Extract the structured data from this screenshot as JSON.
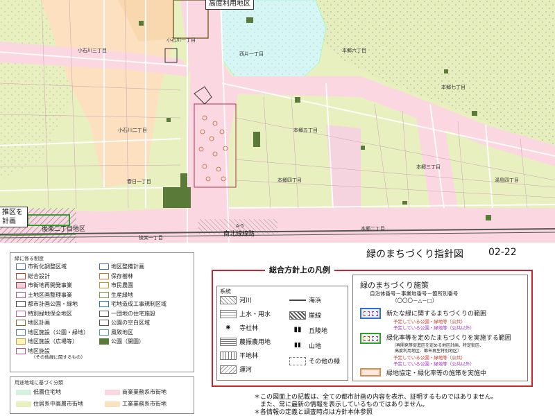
{
  "map": {
    "area_label": "高度利用地区",
    "place_names": {
      "koishikawa_3": "小石川三丁目",
      "koishikawa_2": "小石川二丁目",
      "koishikawa_1": "小石川一丁目",
      "kasuga_1": "春日一丁目",
      "nishikata_1": "西片一丁目",
      "hongo_6": "本郷六丁目",
      "hongo_7": "本郷七丁目",
      "hongo_5": "本郷五丁目",
      "hongo_4": "本郷四丁目",
      "hongo_3": "本郷三丁目",
      "hongo_2": "本郷二丁目",
      "yushima_4": "湯島四丁目",
      "koraku_1": "後楽一丁目",
      "koraku_2": "後楽二丁目地区",
      "a5": "A-5",
      "nanboku": "南北線線路",
      "left_box_1": "推区を",
      "left_box_2": "計画"
    }
  },
  "title": {
    "main": "緑のまちづくり指針図",
    "code": "02-22"
  },
  "legend1": {
    "heading": "緑に係る制度",
    "left": [
      {
        "label": "市街化調整区域",
        "color": "#ffffff",
        "border": "#4a6bb5"
      },
      {
        "label": "総合設計",
        "color": "#ffffff",
        "border": "#c0392b"
      },
      {
        "label": "市街地再開発事業",
        "color": "#f5d0d8",
        "border": "#b03050"
      },
      {
        "label": "土地区画整理事業",
        "color": "#ffffff",
        "border": "#c05070"
      },
      {
        "label": "都市計画公園・緑地",
        "color": "#ffffff",
        "border": "#444444"
      },
      {
        "label": "特別緑地保全地区",
        "color": "#ffffff",
        "border": "#c060a0"
      },
      {
        "label": "地区計画",
        "color": "#ffffff",
        "border": "#7a6a30"
      },
      {
        "label": "地区施設（公園・緑地）",
        "color": "#ffffff",
        "border": "#4a7ab5"
      },
      {
        "label": "地区施設（広場等）",
        "color": "#fff3c0",
        "border": "#c0a040"
      },
      {
        "label": "地区施設",
        "color": "#ffffff",
        "border": "#c05080"
      },
      {
        "label": "（その他緑に関するもの）",
        "color": "",
        "border": ""
      }
    ],
    "right": [
      {
        "label": "地区整備計画",
        "color": "#ffffff",
        "border": "#4a6bb5"
      },
      {
        "label": "保存樹林",
        "color": "#ffffff",
        "border": "#d07030"
      },
      {
        "label": "市民農園",
        "color": "#ffffff",
        "border": "#d09030"
      },
      {
        "label": "生産緑地",
        "color": "#ffffff",
        "border": "#70a040"
      },
      {
        "label": "宅地造成工事規制区域",
        "color": "#ffffff",
        "border": "#2f6fd0"
      },
      {
        "label": "一団地の住宅施設",
        "color": "#ffffff",
        "border": "#555555"
      },
      {
        "label": "公園の空白区域",
        "color": "#ffffff",
        "border": "#555555"
      },
      {
        "label": "風致地区",
        "color": "#ffffff",
        "border": "#4aa0a0"
      },
      {
        "label": "公園（開園）",
        "color": "#5a7a3a",
        "border": "#5a7a3a"
      }
    ]
  },
  "legend2": {
    "heading": "用途地域に基づく分類",
    "items": [
      {
        "label": "低層住宅地",
        "color": "#d8f0e0"
      },
      {
        "label": "商業業務系市街地",
        "color": "#fbd7e2"
      },
      {
        "label": "住居系中高層市街地",
        "color": "#e8f0c0"
      },
      {
        "label": "工業業務系市街地",
        "color": "#fce0c0"
      }
    ]
  },
  "sogo": {
    "title": "総合方針上の凡例",
    "keitou_heading": "系統",
    "keitou_left": [
      "河川",
      "上水・用水",
      "寺社林",
      "農振農用地",
      "平地林",
      "運河"
    ],
    "keitou_right": [
      "海浜",
      "崖線",
      "丘陵地",
      "山地",
      "その他の緑"
    ],
    "shisaku_heading": "緑のまちづくり施策",
    "shisaku_sub": "自治体番号－事業地番号－箇所別番号",
    "shisaku_code": "（〇〇〇－△－□）",
    "item1": "新たな緑に関するまちづくりの範囲",
    "item1_a": "予定している公園・緑地等（公共）",
    "item1_b": "予定している公園・緑地等（公共以外）",
    "item2": "緑化率等を定めたまちづくりを実施する範囲",
    "item2_note1": "（再開発等促進区を定める地区計画、特定街区、",
    "item2_note2": "高度利用地区、都市再生特別地区）",
    "item2_a": "予定している公園・緑地等（公共）",
    "item2_b": "予定している公園・緑地等（公共以外）",
    "item3": "緑地協定・緑化率等の施策を実施中"
  },
  "notes": [
    "＊この図面上の記載は、全ての都市計画の内容を表示、証明するものではありません。",
    "　また、常に最新の情報を表示しているものではありません。",
    "＊各情報の定義と調査時点は方針本体参照"
  ],
  "colors": {
    "commercial": "#fbd7e2",
    "residential_mid": "#e8f0c0",
    "low_res": "#d8f0e0",
    "industrial": "#fce0c0",
    "high_use": "#d6f6f6",
    "park": "#5a7a3a",
    "frame_red": "#c8262c"
  }
}
